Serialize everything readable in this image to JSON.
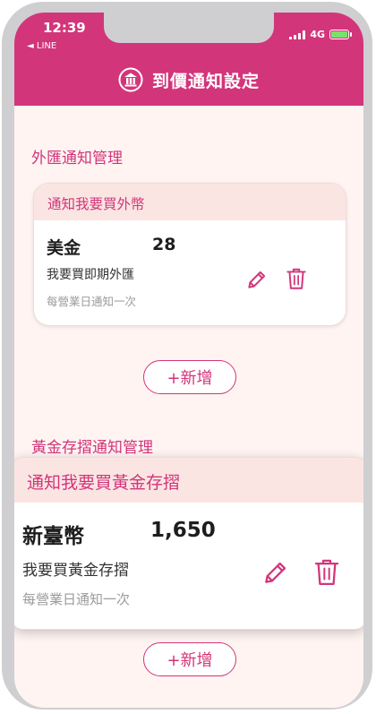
{
  "status_bar": {
    "time": "12:39",
    "back_app": "◄ LINE",
    "network": "4G"
  },
  "header": {
    "title": "到價通知設定",
    "icon": "bank-logo-icon"
  },
  "forex_section": {
    "title": "外匯通知管理",
    "card": {
      "header": "通知我要買外幣",
      "currency": "美金",
      "amount": "28",
      "description": "我要買即期外匯",
      "frequency": "每營業日通知一次"
    },
    "add_label": "+新增"
  },
  "gold_section": {
    "title": "黃金存摺通知管理",
    "card": {
      "header": "通知我要買黃金存摺",
      "currency": "新臺幣",
      "amount": "1,650",
      "description": "我要買黃金存摺",
      "frequency": "每營業日通知一次"
    },
    "add_label": "+新增"
  },
  "colors": {
    "brand": "#d2357a",
    "header_background": "#d2357a",
    "page_background": "#fff4f2",
    "card_header_background": "#fbe5e3"
  }
}
